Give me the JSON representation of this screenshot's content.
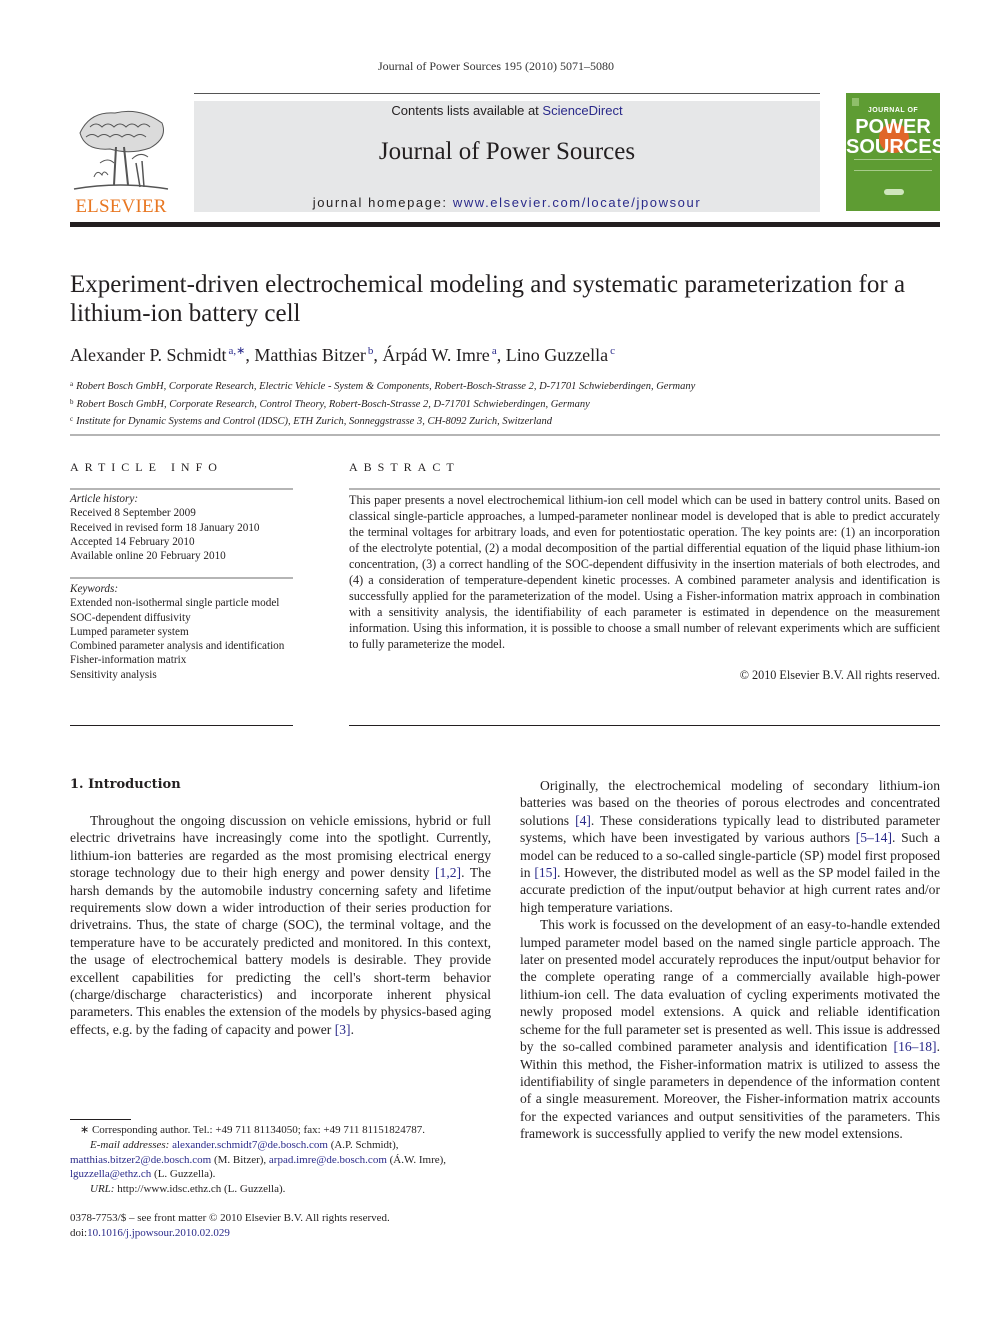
{
  "running_header": "Journal of Power Sources 195 (2010) 5071–5080",
  "masthead": {
    "publisher": "ELSEVIER",
    "contents_prefix": "Contents lists available at ",
    "contents_link": "ScienceDirect",
    "journal_name": "Journal of Power Sources",
    "homepage_prefix": "journal homepage: ",
    "homepage_link": "www.elsevier.com/locate/jpowsour",
    "cover": {
      "top_text": "JOURNAL OF",
      "line1": "POWER",
      "line2": "SOURCES",
      "bg_color": "#5e9c33",
      "accent_color": "#e0662a"
    },
    "brand_color": "#e87722",
    "link_color": "#2a2a8a"
  },
  "article": {
    "title": "Experiment-driven electrochemical modeling and systematic parameterization for a lithium-ion battery cell",
    "authors": [
      {
        "name": "Alexander P. Schmidt",
        "marks": "a,∗"
      },
      {
        "name": "Matthias Bitzer",
        "marks": "b"
      },
      {
        "name": "Árpád W. Imre",
        "marks": "a"
      },
      {
        "name": "Lino Guzzella",
        "marks": "c"
      }
    ],
    "affiliations": [
      {
        "mark": "a",
        "text": "Robert Bosch GmbH, Corporate Research, Electric Vehicle - System & Components, Robert-Bosch-Strasse 2, D-71701 Schwieberdingen, Germany"
      },
      {
        "mark": "b",
        "text": "Robert Bosch GmbH, Corporate Research, Control Theory, Robert-Bosch-Strasse 2, D-71701 Schwieberdingen, Germany"
      },
      {
        "mark": "c",
        "text": "Institute for Dynamic Systems and Control (IDSC), ETH Zurich, Sonneggstrasse 3, CH-8092 Zurich, Switzerland"
      }
    ]
  },
  "article_info": {
    "heading": "ARTICLE INFO",
    "history_label": "Article history:",
    "history": [
      "Received 8 September 2009",
      "Received in revised form 18 January 2010",
      "Accepted 14 February 2010",
      "Available online 20 February 2010"
    ],
    "keywords_label": "Keywords:",
    "keywords": [
      "Extended non-isothermal single particle model",
      "SOC-dependent diffusivity",
      "Lumped parameter system",
      "Combined parameter analysis and identification",
      "Fisher-information matrix",
      "Sensitivity analysis"
    ]
  },
  "abstract": {
    "heading": "ABSTRACT",
    "text": "This paper presents a novel electrochemical lithium-ion cell model which can be used in battery control units. Based on classical single-particle approaches, a lumped-parameter nonlinear model is developed that is able to predict accurately the terminal voltages for arbitrary loads, and even for potentiostatic operation. The key points are: (1) an incorporation of the electrolyte potential, (2) a modal decomposition of the partial differential equation of the liquid phase lithium-ion concentration, (3) a correct handling of the SOC-dependent diffusivity in the insertion materials of both electrodes, and (4) a consideration of temperature-dependent kinetic processes. A combined parameter analysis and identification is successfully applied for the parameterization of the model. Using a Fisher-information matrix approach in combination with a sensitivity analysis, the identifiability of each parameter is estimated in dependence on the measurement information. Using this information, it is possible to choose a small number of relevant experiments which are sufficient to fully parameterize the model.",
    "copyright": "© 2010 Elsevier B.V. All rights reserved."
  },
  "body": {
    "section_heading": "1.  Introduction",
    "left_paragraphs": [
      [
        {
          "t": "Throughout the ongoing discussion on vehicle emissions, hybrid or full electric drivetrains have increasingly come into the spotlight. Currently, lithium-ion batteries are regarded as the most promising electrical energy storage technology due to their high energy and power density "
        },
        {
          "ref": "[1,2]"
        },
        {
          "t": ". The harsh demands by the automobile industry concerning safety and lifetime requirements slow down a wider introduction of their series production for drivetrains. Thus, the state of charge (SOC), the terminal voltage, and the temperature have to be accurately predicted and monitored. In this context, the usage of electrochemical battery models is desirable. They provide excellent capabilities for predicting the cell's short-term behavior (charge/discharge characteristics) and incorporate inherent physical parameters. This enables the extension of the models by physics-based aging effects, e.g. by the fading of capacity and power "
        },
        {
          "ref": "[3]"
        },
        {
          "t": "."
        }
      ]
    ],
    "right_paragraphs": [
      [
        {
          "t": "Originally, the electrochemical modeling of secondary lithium-ion batteries was based on the theories of porous electrodes and concentrated solutions "
        },
        {
          "ref": "[4]"
        },
        {
          "t": ". These considerations typically lead to distributed parameter systems, which have been investigated by various authors "
        },
        {
          "ref": "[5–14]"
        },
        {
          "t": ". Such a model can be reduced to a so-called single-particle (SP) model first proposed in "
        },
        {
          "ref": "[15]"
        },
        {
          "t": ". However, the distributed model as well as the SP model failed in the accurate prediction of the input/output behavior at high current rates and/or high temperature variations."
        }
      ],
      [
        {
          "t": "This work is focussed on the development of an easy-to-handle extended lumped parameter model based on the named single particle approach. The later on presented model accurately reproduces the input/output behavior for the complete operating range of a commercially available high-power lithium-ion cell. The data evaluation of cycling experiments motivated the newly proposed model extensions. A quick and reliable identification scheme for the full parameter set is presented as well. This issue is addressed by the so-called combined parameter analysis and identification "
        },
        {
          "ref": "[16–18]"
        },
        {
          "t": ". Within this method, the Fisher-information matrix is utilized to assess the identifiability of single parameters in dependence of the information content of a single measurement. Moreover, the Fisher-information matrix accounts for the expected variances and output sensitivities of the parameters. This framework is successfully applied to verify the new model extensions."
        }
      ]
    ]
  },
  "footnotes": {
    "corresponding": "∗ Corresponding author. Tel.: +49 711 81134050; fax: +49 711 81151824787.",
    "email_label": "E-mail addresses:",
    "emails": [
      {
        "email": "alexander.schmidt7@de.bosch.com",
        "who": " (A.P. Schmidt),"
      },
      {
        "email": "matthias.bitzer2@de.bosch.com",
        "who": " (M. Bitzer), "
      },
      {
        "email": "arpad.imre@de.bosch.com",
        "who": " (Á.W. Imre),"
      },
      {
        "email": "lguzzella@ethz.ch",
        "who": " (L. Guzzella)."
      }
    ],
    "url_label": "URL:",
    "url_text": " http://www.idsc.ethz.ch (L. Guzzella).",
    "issn_line": "0378-7753/$ – see front matter © 2010 Elsevier B.V. All rights reserved.",
    "doi_prefix": "doi:",
    "doi": "10.1016/j.jpowsour.2010.02.029"
  }
}
